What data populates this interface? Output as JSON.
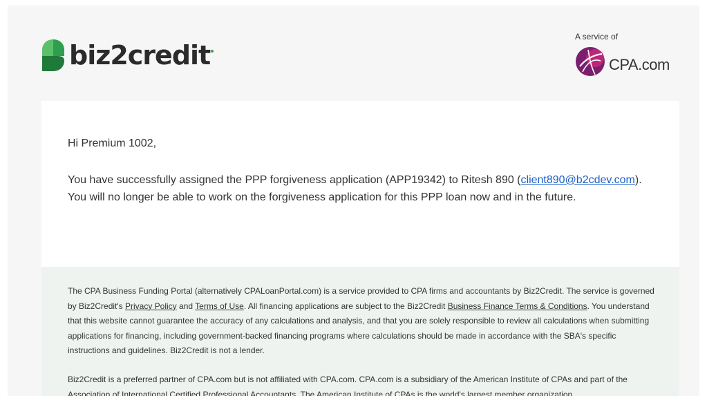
{
  "header": {
    "brand_name": "biz2credit",
    "partner_caption": "A service of",
    "partner_name": "CPA.com"
  },
  "message": {
    "greeting": "Hi Premium 1002,",
    "line_part1": "You have successfully assigned the PPP forgiveness application (APP19342) to Ritesh 890 (",
    "email_link": "client890@b2cdev.com",
    "line_part2": "). You will no longer be able to work on the forgiveness application for this PPP loan now and in the future."
  },
  "footer": {
    "disclaimer_part1": "The CPA Business Funding Portal (alternatively CPALoanPortal.com) is a service provided to CPA firms and accountants by Biz2Credit. The service is governed by Biz2Credit's ",
    "privacy_policy_link": "Privacy Policy",
    "disclaimer_and": " and ",
    "terms_of_use_link": "Terms of Use",
    "disclaimer_part2": ". All financing applications are subject to the Biz2Credit ",
    "business_finance_terms_link": "Business Finance Terms & Conditions",
    "disclaimer_part3": ". You understand that this website cannot guarantee the accuracy of any calculations and analysis, and that you are solely responsible to review all calculations when submitting applications for financing, including government-backed financing programs where calculations should be made in accordance with the SBA's specific instructions and guidelines. Biz2Credit is not a lender.",
    "partner_note": "Biz2Credit is a preferred partner of CPA.com but is not affiliated with CPA.com. CPA.com is a subsidiary of the American Institute of CPAs and part of the Association of International Certified Professional Accountants. The American Institute of CPAs is the world's largest member organization"
  },
  "colors": {
    "brand_green_dark": "#1f7a3a",
    "brand_green_light": "#5cc06b",
    "partner_purple": "#7a1f6e",
    "partner_magenta": "#c8287a",
    "link_blue": "#1a5fc7",
    "footer_bg": "#eef3ef"
  }
}
